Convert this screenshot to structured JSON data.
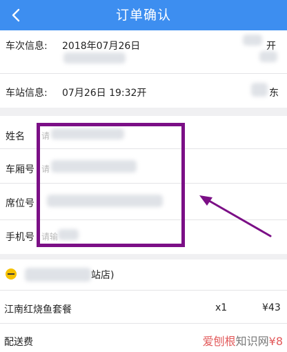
{
  "header": {
    "title": "订单确认"
  },
  "train": {
    "label": "车次信息:",
    "date": "2018年07月26日",
    "right_partial": "开"
  },
  "station": {
    "label": "车站信息:",
    "time": "07月26日 19:32开",
    "right_partial": "东"
  },
  "form": {
    "name": {
      "label": "姓名",
      "placeholder": "请"
    },
    "car": {
      "label": "车厢号",
      "placeholder": "请"
    },
    "seat": {
      "label": "席位号"
    },
    "phone": {
      "label": "手机号",
      "placeholder": "请输"
    }
  },
  "store": {
    "name_suffix": "站店)"
  },
  "items": [
    {
      "name": "江南红烧鱼套餐",
      "qty": "x1",
      "price": "¥43"
    }
  ],
  "delivery": {
    "label": "配送费",
    "price": "¥8"
  },
  "watermark": {
    "text_red": "爱刨根",
    "text_gray": "知识网"
  },
  "colors": {
    "header": "#3d8ef0",
    "annotation": "#7b0f86"
  }
}
